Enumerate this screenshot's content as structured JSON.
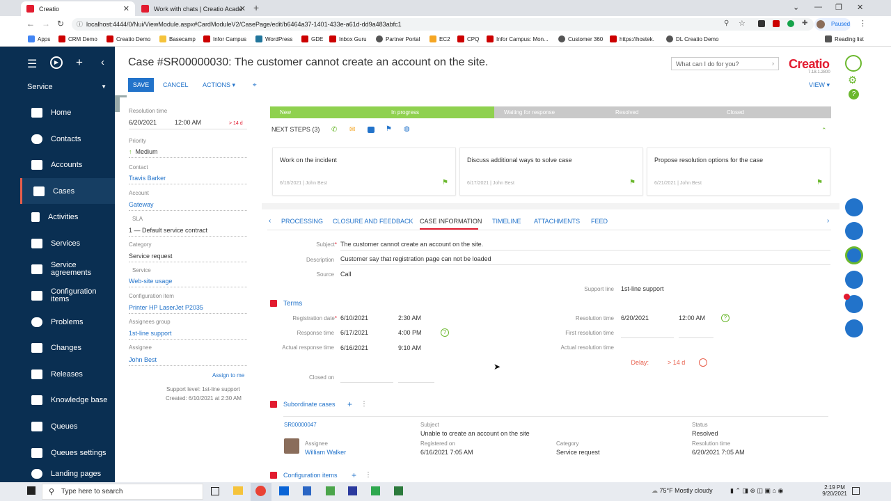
{
  "browser": {
    "tabs": [
      {
        "label": "Creatio"
      },
      {
        "label": "Work with chats | Creatio Acade"
      }
    ],
    "url": "localhost:4444/0/Nui/ViewModule.aspx#CardModuleV2/CasePage/edit/b6464a37-1401-433e-a61d-dd9a483abfc1",
    "profile_status": "Paused",
    "bookmarks": [
      "Apps",
      "CRM Demo",
      "Creatio Demo",
      "Basecamp",
      "Infor Campus",
      "WordPress",
      "GDE",
      "Inbox Guru",
      "Partner Portal",
      "EC2",
      "CPQ",
      "Infor Campus: Mon...",
      "Customer 360",
      "https://hostek.",
      "DL Creatio Demo",
      "Reading list"
    ]
  },
  "nav": {
    "workplace": "Service",
    "items": [
      {
        "label": "Home"
      },
      {
        "label": "Contacts"
      },
      {
        "label": "Accounts"
      },
      {
        "label": "Cases"
      },
      {
        "label": "Activities"
      },
      {
        "label": "Services"
      },
      {
        "label": "Service agreements"
      },
      {
        "label": "Configuration items"
      },
      {
        "label": "Problems"
      },
      {
        "label": "Changes"
      },
      {
        "label": "Releases"
      },
      {
        "label": "Knowledge base"
      },
      {
        "label": "Queues"
      },
      {
        "label": "Queues settings"
      },
      {
        "label": "Landing pages"
      }
    ]
  },
  "header": {
    "title": "Case #SR00000030: The customer cannot create an account on the site.",
    "save": "SAVE",
    "cancel": "CANCEL",
    "actions": "ACTIONS",
    "search_placeholder": "What can I do for you?",
    "logo": "Creatio",
    "version": "7.18.1.2800",
    "view": "VIEW"
  },
  "left_panel": {
    "resolution_time_label": "Resolution time",
    "resolution_date": "6/20/2021",
    "resolution_clock": "12:00 AM",
    "resolution_delta": "> 14 d",
    "priority_label": "Priority",
    "priority": "Medium",
    "contact_label": "Contact",
    "contact": "Travis Barker",
    "account_label": "Account",
    "account": "Gateway",
    "sla_label": "SLA",
    "sla": "1 — Default service contract",
    "category_label": "Category",
    "category": "Service request",
    "service_label": "Service",
    "service": "Web-site usage",
    "config_label": "Configuration item",
    "config": "Printer HP LaserJet P2035",
    "group_label": "Assignees group",
    "group": "1st-line support",
    "assignee_label": "Assignee",
    "assignee": "John Best",
    "assign_to_me": "Assign to me",
    "support_level": "Support level: 1st-line support",
    "created": "Created: 6/10/2021 at 2:30 AM"
  },
  "stages": [
    "New",
    "In progress",
    "Waiting for response",
    "Resolved",
    "Closed"
  ],
  "next_steps": {
    "label": "NEXT STEPS (3)",
    "tasks": [
      {
        "title": "Work on the incident",
        "meta": "6/16/2021 | John Best"
      },
      {
        "title": "Discuss additional ways to solve case",
        "meta": "6/17/2021 | John Best"
      },
      {
        "title": "Propose resolution options for the case",
        "meta": "6/21/2021 | John Best"
      }
    ]
  },
  "tabs": [
    "PROCESSING",
    "CLOSURE AND FEEDBACK",
    "CASE INFORMATION",
    "TIMELINE",
    "ATTACHMENTS",
    "FEED"
  ],
  "case_info": {
    "subject_label": "Subject",
    "subject": "The customer cannot create an account on the site.",
    "description_label": "Description",
    "description": "Customer say that registration page can not be loaded",
    "source_label": "Source",
    "source": "Call",
    "support_line_label": "Support line",
    "support_line": "1st-line support"
  },
  "terms": {
    "title": "Terms",
    "registration_label": "Registration date",
    "registration_date": "6/10/2021",
    "registration_time": "2:30 AM",
    "response_label": "Response time",
    "response_date": "6/17/2021",
    "response_time": "4:00 PM",
    "actual_response_label": "Actual response time",
    "actual_response_date": "6/16/2021",
    "actual_response_time": "9:10 AM",
    "closed_label": "Closed on",
    "resolution_label": "Resolution time",
    "resolution_date": "6/20/2021",
    "resolution_time": "12:00 AM",
    "first_resolution_label": "First resolution time",
    "actual_resolution_label": "Actual resolution time",
    "delay_label": "Delay:",
    "delay_value": "> 14 d"
  },
  "subordinate": {
    "title": "Subordinate cases",
    "number": "SR00000047",
    "subject_label": "Subject",
    "subject": "Unable to create an account on the site",
    "status_label": "Status",
    "status": "Resolved",
    "assignee_label": "Assignee",
    "assignee": "William Walker",
    "registered_label": "Registered on",
    "registered": "6/16/2021 7:05 AM",
    "category_label": "Category",
    "category": "Service request",
    "resolution_label": "Resolution time",
    "resolution": "6/20/2021 7:05 AM"
  },
  "config_items": {
    "title": "Configuration items"
  },
  "taskbar": {
    "search": "Type here to search",
    "weather": "75°F  Mostly cloudy",
    "time": "2:19 PM",
    "date": "9/20/2021"
  },
  "colors": {
    "brand": "#e21b2f",
    "nav": "#0a2f52",
    "accent": "#2273ca",
    "stage_done": "#8fd14f",
    "stage_todo": "#c9c9c9"
  }
}
